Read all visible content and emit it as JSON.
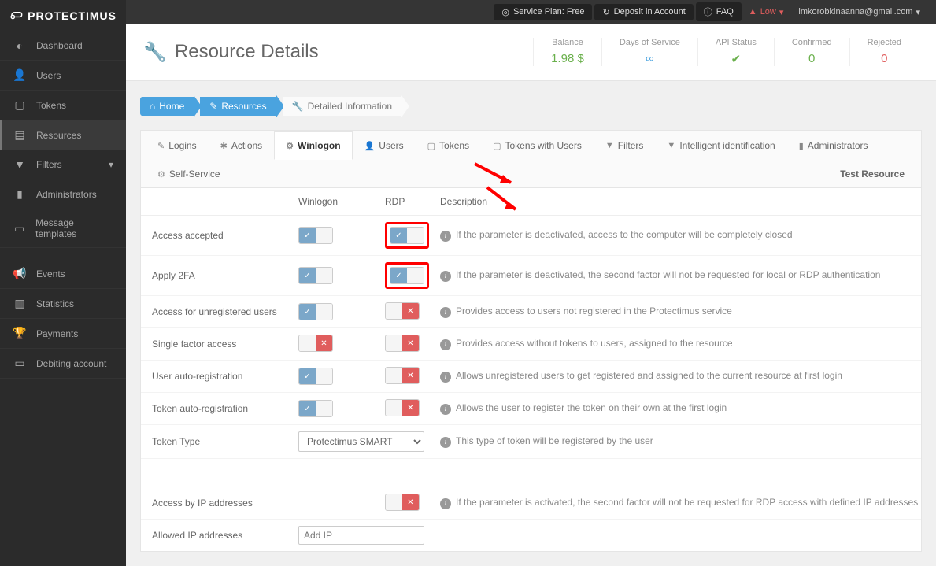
{
  "brand": "PROTECTIMUS",
  "topbar": {
    "plan": "Service Plan: Free",
    "deposit": "Deposit in Account",
    "faq": "FAQ",
    "user_level": "Low",
    "email": "imkorobkinaanna@gmail.com"
  },
  "sidebar": {
    "items": [
      {
        "icon": "tachometer",
        "label": "Dashboard"
      },
      {
        "icon": "user",
        "label": "Users"
      },
      {
        "icon": "tablet",
        "label": "Tokens"
      },
      {
        "icon": "layers",
        "label": "Resources",
        "active": true
      },
      {
        "icon": "filter",
        "label": "Filters"
      },
      {
        "icon": "bars",
        "label": "Administrators"
      },
      {
        "icon": "doc",
        "label": "Message templates"
      },
      {
        "icon": "bullhorn",
        "label": "Events"
      },
      {
        "icon": "chart",
        "label": "Statistics"
      },
      {
        "icon": "trophy",
        "label": "Payments"
      },
      {
        "icon": "card",
        "label": "Debiting account"
      }
    ]
  },
  "page": {
    "title": "Resource Details",
    "kpis": [
      {
        "label": "Balance",
        "value": "1.98 $",
        "cls": "val-green"
      },
      {
        "label": "Days of Service",
        "value": "∞",
        "cls": "val-blue"
      },
      {
        "label": "API Status",
        "value": "✔",
        "cls": "val-green"
      },
      {
        "label": "Confirmed",
        "value": "0",
        "cls": "val-green"
      },
      {
        "label": "Rejected",
        "value": "0",
        "cls": "val-red"
      }
    ]
  },
  "breadcrumb": {
    "home": "Home",
    "resources": "Resources",
    "current": "Detailed Information"
  },
  "tabs": [
    {
      "icon": "✎",
      "label": "Logins"
    },
    {
      "icon": "✱",
      "label": "Actions"
    },
    {
      "icon": "⚙",
      "label": "Winlogon",
      "active": true
    },
    {
      "icon": "👤",
      "label": "Users"
    },
    {
      "icon": "▢",
      "label": "Tokens"
    },
    {
      "icon": "▢",
      "label": "Tokens with Users"
    },
    {
      "icon": "▼",
      "label": "Filters"
    },
    {
      "icon": "▼",
      "label": "Intelligent identification"
    },
    {
      "icon": "▮",
      "label": "Administrators"
    },
    {
      "icon": "⚙",
      "label": "Self-Service"
    }
  ],
  "tab_right": "Test Resource",
  "headers": {
    "winlogon": "Winlogon",
    "rdp": "RDP",
    "desc": "Description"
  },
  "rows": [
    {
      "label": "Access accepted",
      "win": true,
      "rdp": true,
      "hl_rdp": true,
      "desc": "If the parameter is deactivated, access to the computer will be completely closed"
    },
    {
      "label": "Apply 2FA",
      "win": true,
      "rdp": true,
      "hl_rdp": true,
      "desc": "If the parameter is deactivated, the second factor will not be requested for local or RDP authentication"
    },
    {
      "label": "Access for unregistered users",
      "win": true,
      "rdp": false,
      "desc": "Provides access to users not registered in the Protectimus service"
    },
    {
      "label": "Single factor access",
      "win": false,
      "rdp": false,
      "desc": "Provides access without tokens to users, assigned to the resource"
    },
    {
      "label": "User auto-registration",
      "win": true,
      "rdp": false,
      "desc": "Allows unregistered users to get registered and assigned to the current resource at first login"
    },
    {
      "label": "Token auto-registration",
      "win": true,
      "rdp": false,
      "desc": "Allows the user to register the token on their own at the first login"
    }
  ],
  "token_type": {
    "label": "Token Type",
    "value": "Protectimus SMART",
    "desc": "This type of token will be registered by the user"
  },
  "access_ip": {
    "label": "Access by IP addresses",
    "state": false,
    "desc": "If the parameter is activated, the second factor will not be requested for RDP access with defined IP addresses"
  },
  "allowed_ip": {
    "label": "Allowed IP addresses",
    "placeholder": "Add IP"
  }
}
